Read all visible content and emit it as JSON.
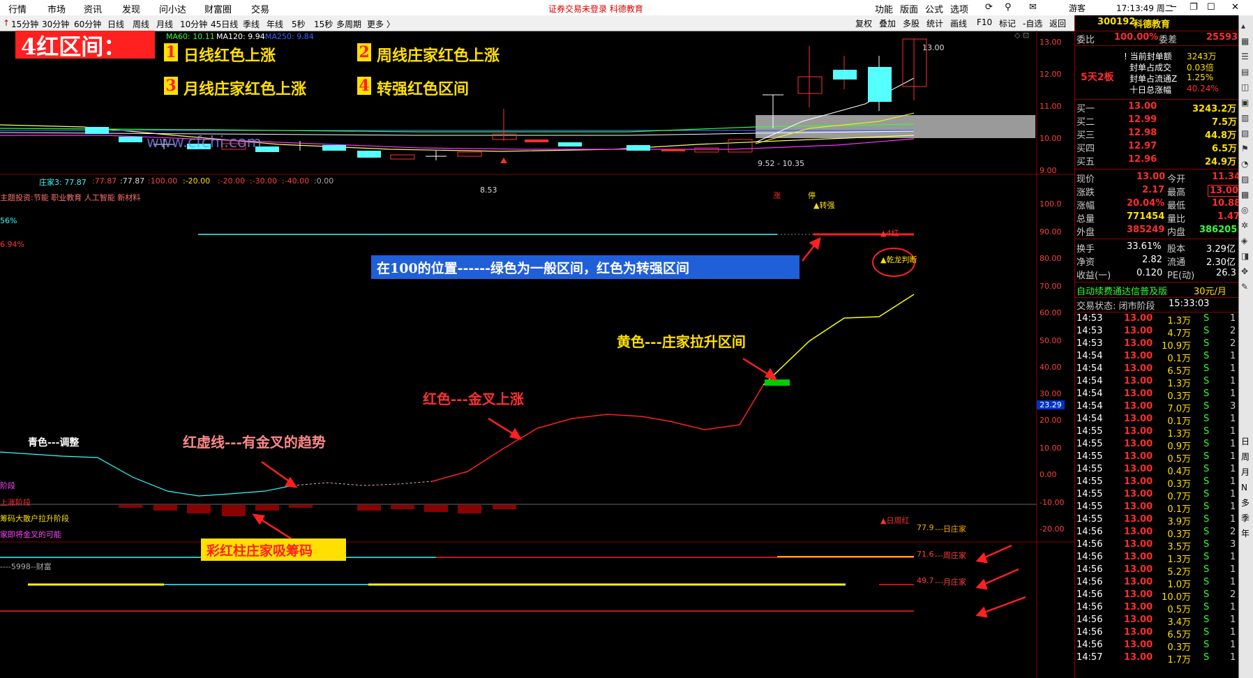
{
  "menu": {
    "items": [
      "行情",
      "市场",
      "资讯",
      "发现",
      "问小达",
      "财富圈",
      "交易"
    ],
    "notice": "证券交易未登录  科德教育",
    "right": [
      "功能",
      "版面",
      "公式",
      "选项"
    ],
    "user": "游客",
    "clock": "17:13:49 周二"
  },
  "periods": [
    "15分钟",
    "30分钟",
    "60分钟",
    "日线",
    "周线",
    "月线",
    "10分钟",
    "45日线",
    "季线",
    "年线",
    "5秒",
    "15秒",
    "多周期",
    "更多 〉"
  ],
  "toolbar_right": [
    "复权",
    "叠加",
    "多股",
    "统计",
    "画线",
    "F10",
    "标记",
    "-自选",
    "返回"
  ],
  "ma_legend": [
    {
      "text": "MA60: 10.11",
      "color": "#33ff33"
    },
    {
      "text": "MA120: 9.94",
      "color": "#ffffff"
    },
    {
      "text": "MA250: 9.84",
      "color": "#3366ff"
    }
  ],
  "price_axis": [
    "13.00",
    "12.00",
    "11.00",
    "10.00",
    "9.00"
  ],
  "price_labels": {
    "high": "13.00",
    "low": "8.53",
    "range": "9.52 - 10.35",
    "zhang": "涨",
    "ting": "停"
  },
  "watermark": "www.cfchi.com",
  "overlay": {
    "title": "4红区间：",
    "items": [
      {
        "num": "1",
        "text": "日线红色上涨"
      },
      {
        "num": "2",
        "text": "周线庄家红色上涨"
      },
      {
        "num": "3",
        "text": "月线庄家红色上涨"
      },
      {
        "num": "4",
        "text": "转强红色区间"
      }
    ]
  },
  "indicator": {
    "header_name": "庄家3: 77.87",
    "header_vals": [
      ":77.87",
      ":77.87",
      ":100.00",
      ":-20.00",
      ":-20.00",
      ":-30.00",
      ":-40.00",
      ":0.00"
    ],
    "topics": "主题投资:节能 职业教育 人工智能 新材料",
    "pct1": "56%",
    "pct2": "6.94%",
    "axis": [
      "100.0",
      "90.00",
      "80.00",
      "70.00",
      "60.00",
      "50.00",
      "40.00",
      "30.00",
      "20.00",
      "10.00",
      "0.00",
      "-10.00",
      "-20.00"
    ],
    "marker_value": "23.29",
    "labels": {
      "zhuanqiang": "▲转强",
      "sihong": "▲4红",
      "qianlong": "▲乾龙判断",
      "rizhouhong": "▲日周红"
    },
    "left_labels": [
      "阶段",
      "上涨阶段",
      "筹码大散户拉升阶段",
      "家即将金叉的可能",
      "----5998--财富"
    ],
    "zhuang": [
      {
        "value": "77.9",
        "label": "---日庄家"
      },
      {
        "value": "71.6",
        "label": "---周庄家"
      },
      {
        "value": "49.7",
        "label": "---月庄家"
      }
    ]
  },
  "annotations": {
    "blue_box": "在100的位置------绿色为一般区间，红色为转强区间",
    "yellow": "黄色---庄家拉升区间",
    "red": "红色---金叉上涨",
    "dashed": "红虚线---有金叉的趋势",
    "cyan": "青色---调整",
    "bars": "彩红柱庄家吸筹码"
  },
  "quote": {
    "code": "300192",
    "name": "科德教育",
    "weibi_label": "委比",
    "weibi": "100.00%",
    "weicha_label": "委差",
    "weicha": "25593",
    "board": "5天2板",
    "seal": [
      {
        "label": "当前封单额",
        "value": "3243万"
      },
      {
        "label": "封单占成交",
        "value": "0.03倍"
      },
      {
        "label": "封单占流通Z",
        "value": "1.25%"
      },
      {
        "label": "十日总涨幅",
        "value": "40.24%"
      }
    ],
    "bids": [
      {
        "label": "买一",
        "price": "13.00",
        "vol": "3243.2万"
      },
      {
        "label": "买二",
        "price": "12.99",
        "vol": "7.5万"
      },
      {
        "label": "买三",
        "price": "12.98",
        "vol": "44.8万"
      },
      {
        "label": "买四",
        "price": "12.97",
        "vol": "6.5万"
      },
      {
        "label": "买五",
        "price": "12.96",
        "vol": "24.9万"
      }
    ],
    "stats": [
      {
        "l1": "现价",
        "v1": "13.00",
        "l2": "今开",
        "v2": "11.34",
        "c1": "#ff2d2d",
        "c2": "#ff2d2d"
      },
      {
        "l1": "涨跌",
        "v1": "2.17",
        "l2": "最高",
        "v2": "13.00",
        "c1": "#ff2d2d",
        "c2": "#ff2d2d"
      },
      {
        "l1": "涨幅",
        "v1": "20.04%",
        "l2": "最低",
        "v2": "10.88",
        "c1": "#ff2d2d",
        "c2": "#ff2d2d"
      },
      {
        "l1": "总量",
        "v1": "771454",
        "l2": "量比",
        "v2": "1.47",
        "c1": "#ffe000",
        "c2": "#ff2d2d"
      },
      {
        "l1": "外盘",
        "v1": "385249",
        "l2": "内盘",
        "v2": "386205",
        "c1": "#ff2d2d",
        "c2": "#33ff33"
      }
    ],
    "stats2": [
      {
        "l1": "换手",
        "v1": "33.61%",
        "l2": "股本",
        "v2": "3.29亿"
      },
      {
        "l1": "净资",
        "v1": "2.82",
        "l2": "流通",
        "v2": "2.30亿"
      },
      {
        "l1": "收益(一)",
        "v1": "0.120",
        "l2": "PE(动)",
        "v2": "26.3"
      }
    ],
    "promo": "自动续费通达信普及版",
    "promo_price": "30元/月",
    "trade_state": "交易状态: 闭市阶段",
    "trade_time": "15:33:03",
    "ticks": [
      [
        "14:53",
        "13.00",
        "1.3万",
        "S",
        "1"
      ],
      [
        "14:53",
        "13.00",
        "4.7万",
        "S",
        "2"
      ],
      [
        "14:53",
        "13.00",
        "10.9万",
        "S",
        "2"
      ],
      [
        "14:54",
        "13.00",
        "0.1万",
        "S",
        "1"
      ],
      [
        "14:54",
        "13.00",
        "6.5万",
        "S",
        "1"
      ],
      [
        "14:54",
        "13.00",
        "1.3万",
        "S",
        "1"
      ],
      [
        "14:54",
        "13.00",
        "0.3万",
        "S",
        "1"
      ],
      [
        "14:54",
        "13.00",
        "7.0万",
        "S",
        "3"
      ],
      [
        "14:54",
        "13.00",
        "0.1万",
        "S",
        "1"
      ],
      [
        "14:55",
        "13.00",
        "1.3万",
        "S",
        "1"
      ],
      [
        "14:55",
        "13.00",
        "0.9万",
        "S",
        "1"
      ],
      [
        "14:55",
        "13.00",
        "0.5万",
        "S",
        "1"
      ],
      [
        "14:55",
        "13.00",
        "0.4万",
        "S",
        "1"
      ],
      [
        "14:55",
        "13.00",
        "0.3万",
        "S",
        "1"
      ],
      [
        "14:55",
        "13.00",
        "0.7万",
        "S",
        "1"
      ],
      [
        "14:55",
        "13.00",
        "0.1万",
        "S",
        "1"
      ],
      [
        "14:55",
        "13.00",
        "3.9万",
        "S",
        "1"
      ],
      [
        "14:56",
        "13.00",
        "0.3万",
        "S",
        "2"
      ],
      [
        "14:56",
        "13.00",
        "3.5万",
        "S",
        "3"
      ],
      [
        "14:56",
        "13.00",
        "1.3万",
        "S",
        "1"
      ],
      [
        "14:56",
        "13.00",
        "5.2万",
        "S",
        "1"
      ],
      [
        "14:56",
        "13.00",
        "1.0万",
        "S",
        "1"
      ],
      [
        "14:56",
        "13.00",
        "10.0万",
        "S",
        "2"
      ],
      [
        "14:56",
        "13.00",
        "0.5万",
        "S",
        "1"
      ],
      [
        "14:56",
        "13.00",
        "3.4万",
        "S",
        "1"
      ],
      [
        "14:56",
        "13.00",
        "6.5万",
        "S",
        "1"
      ],
      [
        "14:56",
        "13.00",
        "0.3万",
        "S",
        "1"
      ],
      [
        "14:57",
        "13.00",
        "1.7万",
        "S",
        "1"
      ]
    ]
  },
  "sidebar_tabs": [
    "日",
    "周",
    "月",
    "N",
    "多",
    "季",
    "年"
  ]
}
